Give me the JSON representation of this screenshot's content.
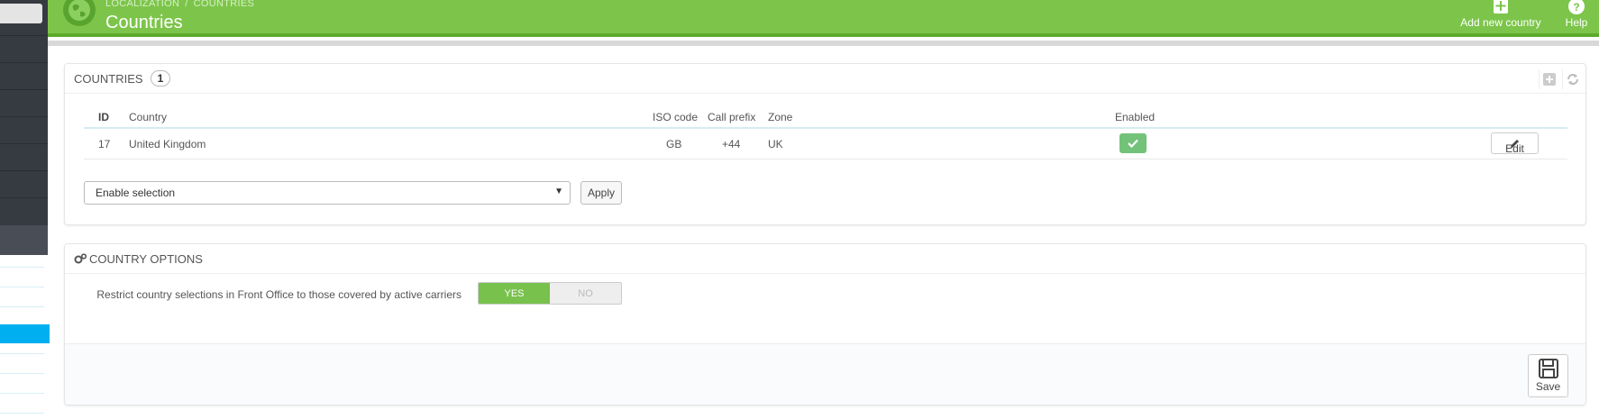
{
  "header": {
    "breadcrumb": [
      "LOCALIZATION",
      "COUNTRIES"
    ],
    "title": "Countries",
    "add_label": "Add new country",
    "help_label": "Help",
    "accent": "#7cc54a"
  },
  "countries_panel": {
    "title": "COUNTRIES",
    "count": "1",
    "columns": {
      "id": "ID",
      "country": "Country",
      "iso": "ISO code",
      "prefix": "Call prefix",
      "zone": "Zone",
      "enabled": "Enabled"
    },
    "rows": [
      {
        "id": "17",
        "country": "United Kingdom",
        "iso": "GB",
        "prefix": "+44",
        "zone": "UK",
        "enabled": true,
        "edit_label": "Edit"
      }
    ],
    "bulk_action": "Enable selection",
    "apply_label": "Apply"
  },
  "options_panel": {
    "title": "COUNTRY OPTIONS",
    "restrict_label": "Restrict country selections in Front Office to those covered by active carriers",
    "yes_label": "YES",
    "no_label": "NO",
    "save_label": "Save"
  }
}
